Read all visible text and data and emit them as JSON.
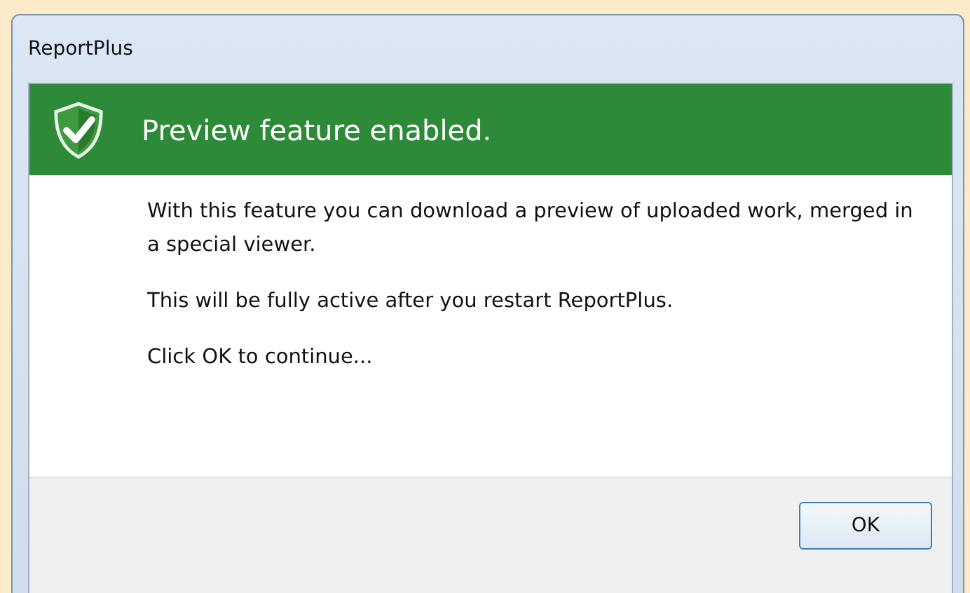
{
  "window": {
    "title": "ReportPlus"
  },
  "banner": {
    "title": "Preview feature enabled."
  },
  "paragraphs": [
    "With this feature you can download a preview of uploaded work, merged in a special viewer.",
    "This will be fully active after you restart ReportPlus.",
    "Click OK to continue..."
  ],
  "buttons": [
    "OK"
  ]
}
